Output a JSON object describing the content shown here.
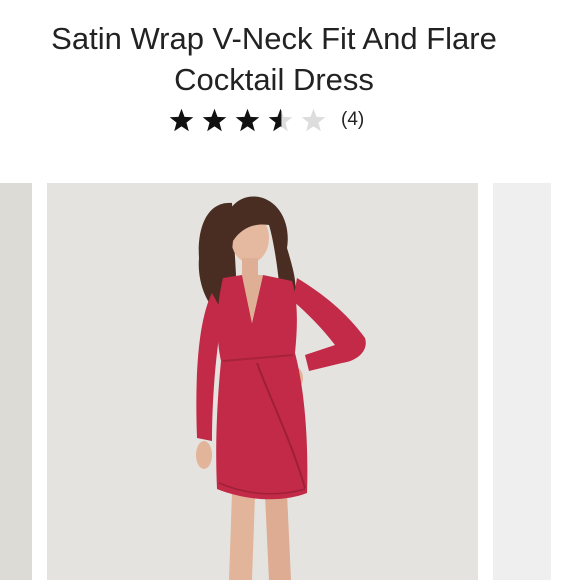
{
  "product": {
    "title": "Satin Wrap V-Neck Fit And Flare Cocktail Dress",
    "rating_value": 3.5,
    "rating_max": 5,
    "review_count_label": "(4)"
  },
  "icons": {
    "star_filled": "star-icon",
    "star_half": "star-half-icon",
    "star_empty": "star-empty-icon"
  },
  "colors": {
    "star_filled": "#111111",
    "star_empty": "#dddddd",
    "dress": "#c32a48",
    "slide_background": "#e4e3df"
  }
}
